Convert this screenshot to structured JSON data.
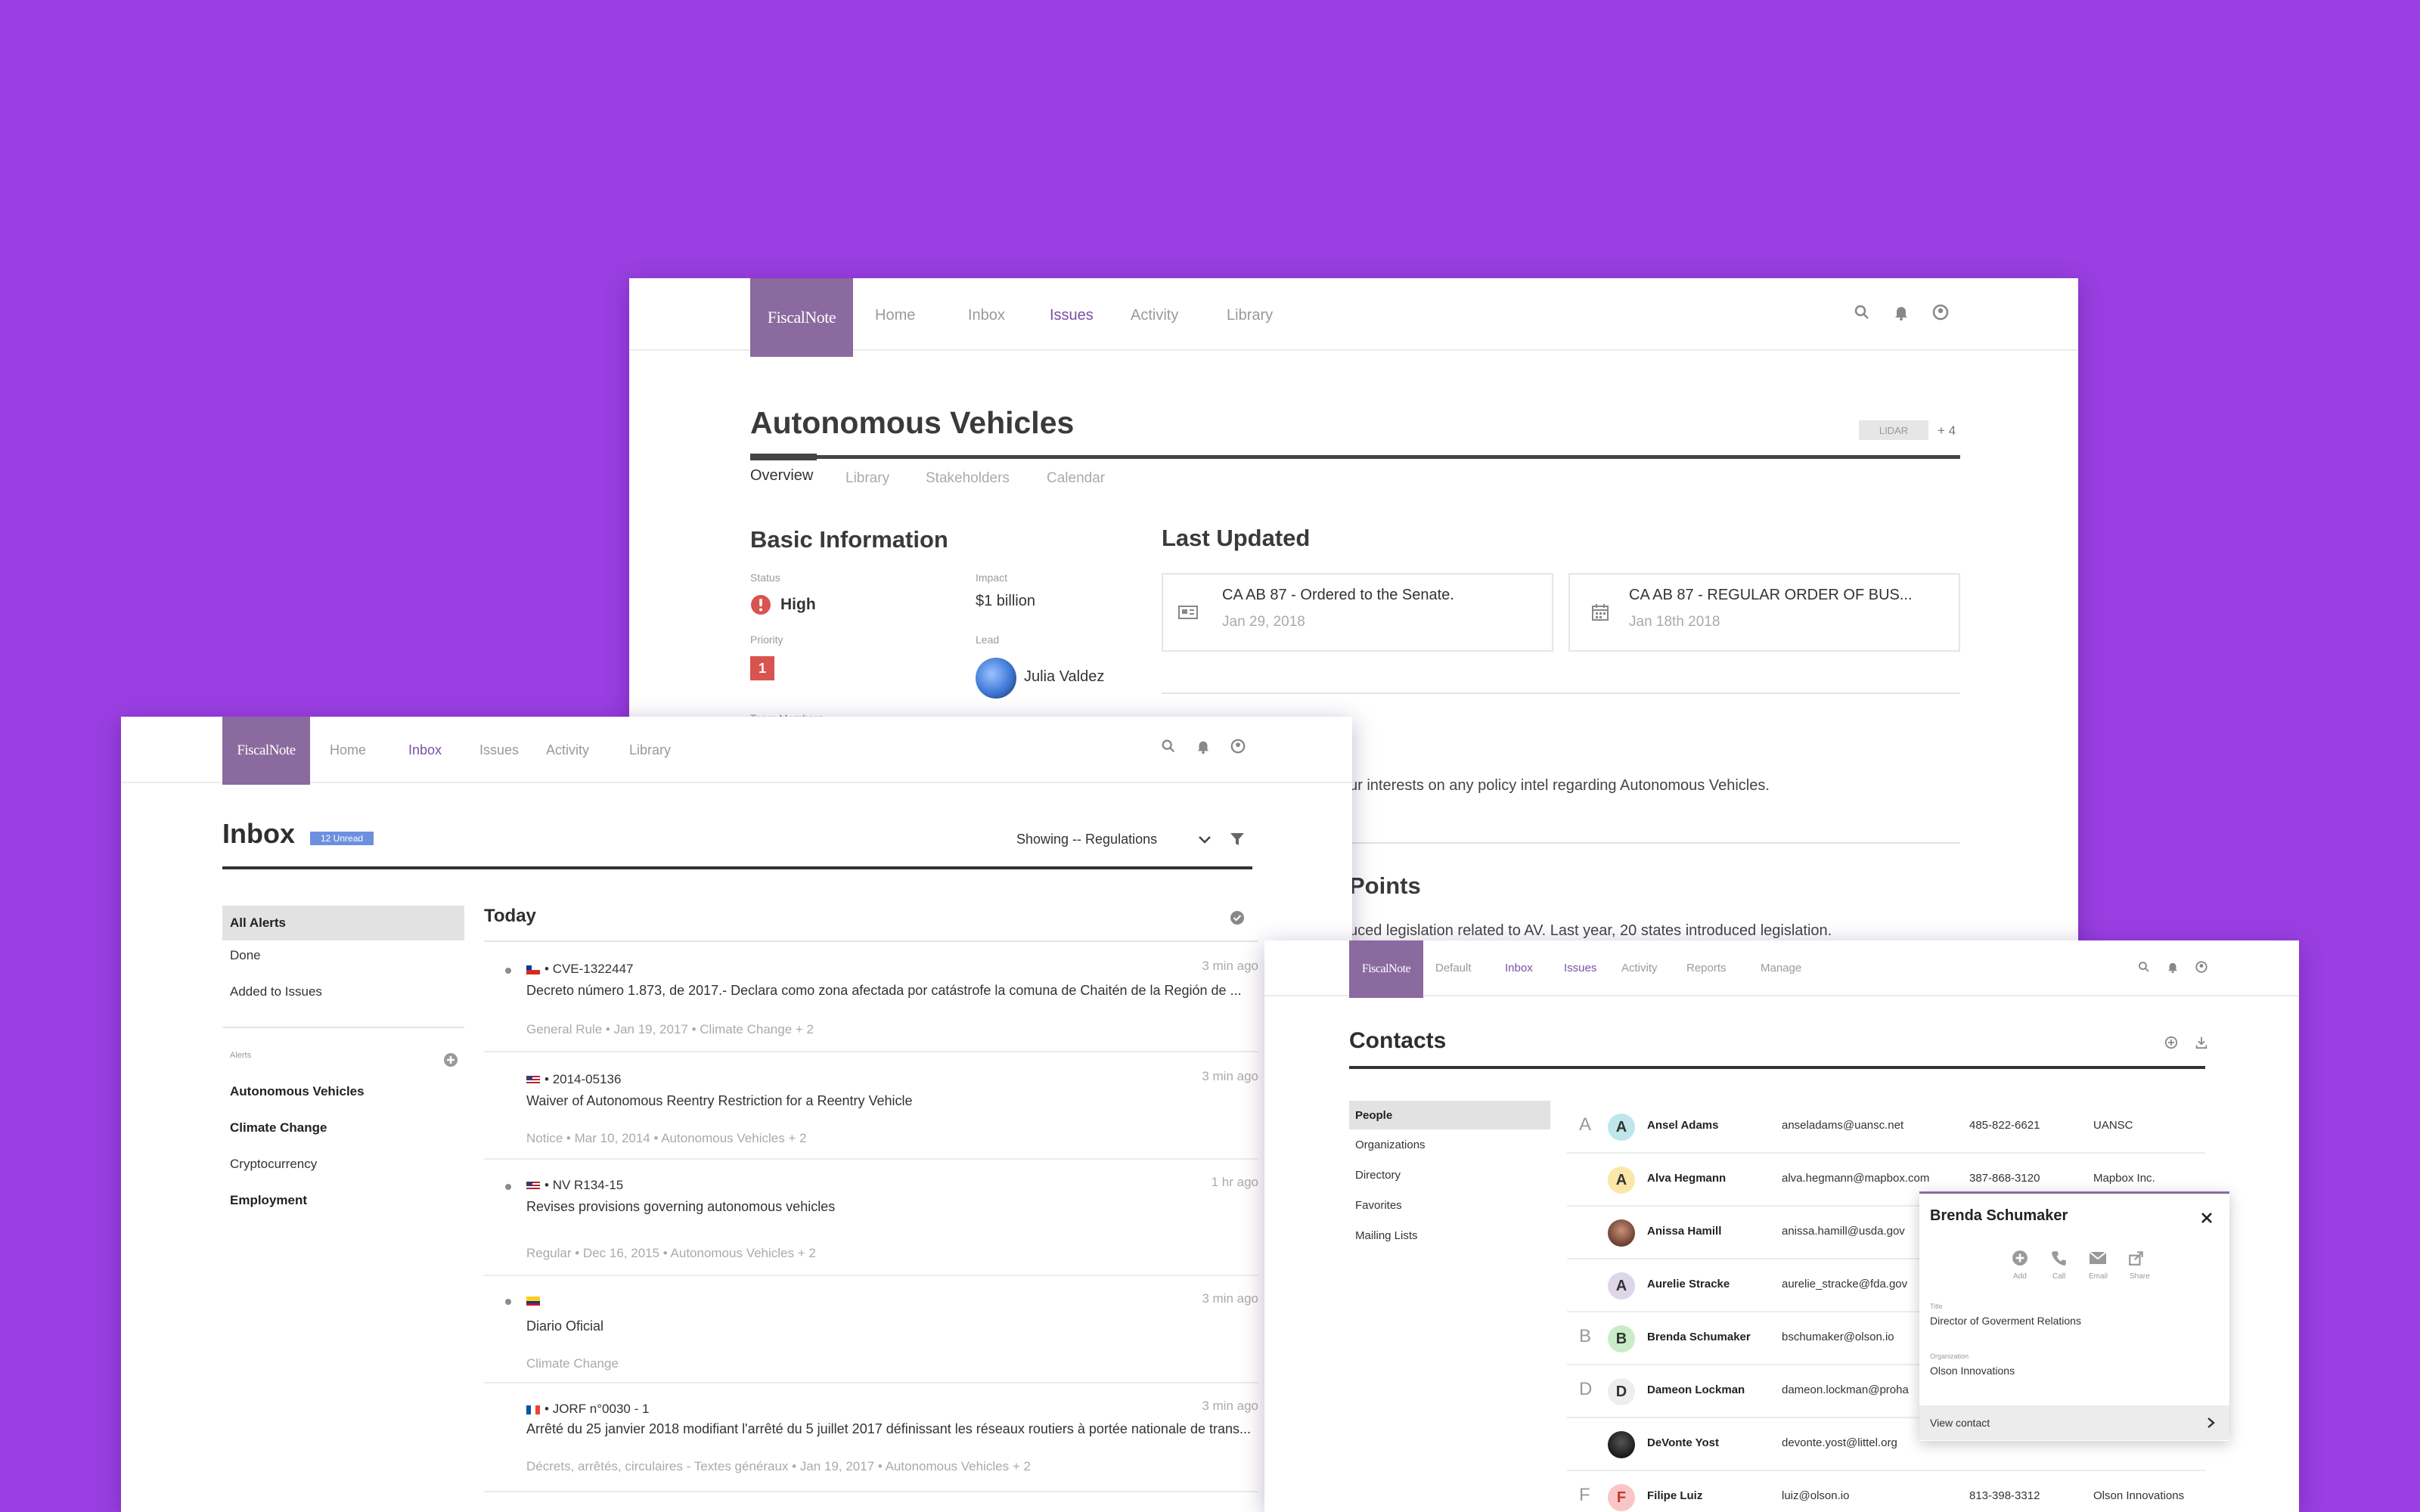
{
  "issues_window": {
    "logo": "FiscalNote",
    "nav": [
      "Home",
      "Inbox",
      "Issues",
      "Activity",
      "Library"
    ],
    "active_nav": "Issues",
    "icons": [
      "search-icon",
      "bell-icon",
      "user-icon"
    ],
    "title": "Autonomous Vehicles",
    "tag": "LIDAR",
    "tag_more": "+ 4",
    "tabs": [
      "Overview",
      "Library",
      "Stakeholders",
      "Calendar"
    ],
    "basic_info": {
      "heading": "Basic Information",
      "status_label": "Status",
      "status_value": "High",
      "impact_label": "Impact",
      "impact_value": "$1 billion",
      "priority_label": "Priority",
      "priority_value": "1",
      "lead_label": "Lead",
      "lead_value": "Julia Valdez",
      "team_label": "Team Members"
    },
    "last_updated": {
      "heading": "Last Updated",
      "items": [
        {
          "title": "CA AB 87 - Ordered to the Senate.",
          "date": "Jan 29, 2018",
          "icon": "bill-icon"
        },
        {
          "title": "CA AB 87 - REGULAR ORDER OF BUS...",
          "date": "Jan 18th 2018",
          "icon": "calendar-icon"
        }
      ]
    },
    "description_text": "ur interests on any policy intel regarding Autonomous Vehicles.",
    "points_heading": "Points",
    "points_text": "uced legislation related to AV. Last year, 20 states introduced legislation."
  },
  "inbox_window": {
    "logo": "FiscalNote",
    "nav": [
      "Home",
      "Inbox",
      "Issues",
      "Activity",
      "Library"
    ],
    "active_nav": "Inbox",
    "title": "Inbox",
    "unread_badge": "12 Unread",
    "filter_label": "Showing -- Regulations",
    "sidebar": {
      "items": [
        "All Alerts",
        "Done",
        "Added to Issues"
      ],
      "selected": "All Alerts",
      "alerts_label": "Alerts",
      "alerts": [
        {
          "label": "Autonomous Vehicles",
          "bold": true
        },
        {
          "label": "Climate Change",
          "bold": true
        },
        {
          "label": "Cryptocurrency",
          "bold": false
        },
        {
          "label": "Employment",
          "bold": true
        }
      ]
    },
    "today_heading": "Today",
    "alerts": [
      {
        "code": "CVE-1322447",
        "flag": "cl",
        "time": "3 min ago",
        "title": "Decreto número 1.873, de 2017.- Declara como zona afectada por catástrofe la comuna de Chaitén de la Región de ...",
        "meta": "General Rule • Jan 19, 2017 • Climate Change + 2"
      },
      {
        "code": "2014-05136",
        "flag": "us",
        "time": "3 min ago",
        "title": "Waiver of Autonomous Reentry Restriction for a Reentry Vehicle",
        "meta": "Notice • Mar 10, 2014 • Autonomous Vehicles + 2"
      },
      {
        "code": "NV R134-15",
        "flag": "us",
        "time": "1 hr ago",
        "title": "Revises provisions governing autonomous vehicles",
        "meta": "Regular • Dec 16, 2015 • Autonomous Vehicles + 2"
      },
      {
        "code": "",
        "flag": "co",
        "time": "3 min ago",
        "title": "Diario Oficial",
        "meta": "Climate Change"
      },
      {
        "code": "JORF n°0030 - 1",
        "flag": "fr",
        "time": "3 min ago",
        "title": "Arrêté du 25 janvier 2018 modifiant l'arrêté du 5 juillet 2017 définissant les réseaux routiers à portée nationale de trans...",
        "meta": "Décrets, arrêtés, circulaires - Textes généraux • Jan 19, 2017 • Autonomous Vehicles + 2"
      }
    ]
  },
  "contacts_window": {
    "logo": "FiscalNote",
    "nav": [
      "Default",
      "Inbox",
      "Issues",
      "Activity",
      "Reports",
      "Manage"
    ],
    "active_nav": [
      "Inbox",
      "Issues"
    ],
    "title": "Contacts",
    "sidebar": [
      "People",
      "Organizations",
      "Directory",
      "Favorites",
      "Mailing Lists"
    ],
    "selected": "People",
    "contacts": [
      {
        "letter": "A",
        "initial": "A",
        "name": "Ansel Adams",
        "email": "anseladams@uansc.net",
        "phone": "485-822-6621",
        "org": "UANSC",
        "color": "#bfe6ea"
      },
      {
        "letter": "",
        "initial": "A",
        "name": "Alva Hegmann",
        "email": "alva.hegmann@mapbox.com",
        "phone": "387-868-3120",
        "org": "Mapbox Inc.",
        "color": "#fbe8a8"
      },
      {
        "letter": "",
        "initial": "",
        "name": "Anissa Hamill",
        "email": "anissa.hamill@usda.gov",
        "phone": "",
        "org": "",
        "color": "#8a5a4a"
      },
      {
        "letter": "",
        "initial": "A",
        "name": "Aurelie Stracke",
        "email": "aurelie_stracke@fda.gov",
        "phone": "",
        "org": "",
        "color": "#dcd6e8"
      },
      {
        "letter": "B",
        "initial": "B",
        "name": "Brenda Schumaker",
        "email": "bschumaker@olson.io",
        "phone": "",
        "org": "",
        "color": "#c9ecc6"
      },
      {
        "letter": "D",
        "initial": "D",
        "name": "Dameon Lockman",
        "email": "dameon.lockman@proha",
        "phone": "",
        "org": "",
        "color": "#eeeeee"
      },
      {
        "letter": "",
        "initial": "",
        "name": "DeVonte Yost",
        "email": "devonte.yost@littel.org",
        "phone": "",
        "org": "",
        "color": "#222222"
      },
      {
        "letter": "F",
        "initial": "F",
        "name": "Filipe Luiz",
        "email": "luiz@olson.io",
        "phone": "813-398-3312",
        "org": "Olson Innovations",
        "color": "#f8c6c6"
      }
    ],
    "popup": {
      "name": "Brenda Schumaker",
      "actions": [
        "Add",
        "Call",
        "Email",
        "Share"
      ],
      "title_label": "Title",
      "title_value": "Director of Goverment Relations",
      "org_label": "Organization",
      "org_value": "Olson Innovations",
      "view_label": "View contact"
    }
  },
  "colors": {
    "background": "#9a3fe2",
    "brand": "#8b6a9f",
    "accent": "#7a4fa6",
    "high": "#d9534f",
    "badge": "#6c8fe0"
  }
}
